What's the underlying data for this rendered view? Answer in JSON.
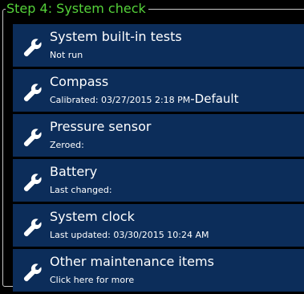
{
  "step_title": "Step 4: System check",
  "colors": {
    "legend": "#55d23a",
    "item_bg": "#0c2d5a",
    "border": "#c8c8c8"
  },
  "items": [
    {
      "icon": "wrench-icon",
      "title": "System built-in tests",
      "subtitle": "Not run",
      "suffix": ""
    },
    {
      "icon": "wrench-icon",
      "title": "Compass",
      "subtitle": "Calibrated: 03/27/2015 2:18 PM",
      "suffix": "-Default"
    },
    {
      "icon": "wrench-icon",
      "title": "Pressure sensor",
      "subtitle": "Zeroed:",
      "suffix": ""
    },
    {
      "icon": "wrench-icon",
      "title": "Battery",
      "subtitle": "Last changed:",
      "suffix": ""
    },
    {
      "icon": "wrench-icon",
      "title": "System clock",
      "subtitle": "Last updated: 03/30/2015 10:24 AM",
      "suffix": ""
    },
    {
      "icon": "wrench-icon",
      "title": "Other maintenance items",
      "subtitle": "Click here for more",
      "suffix": ""
    }
  ]
}
